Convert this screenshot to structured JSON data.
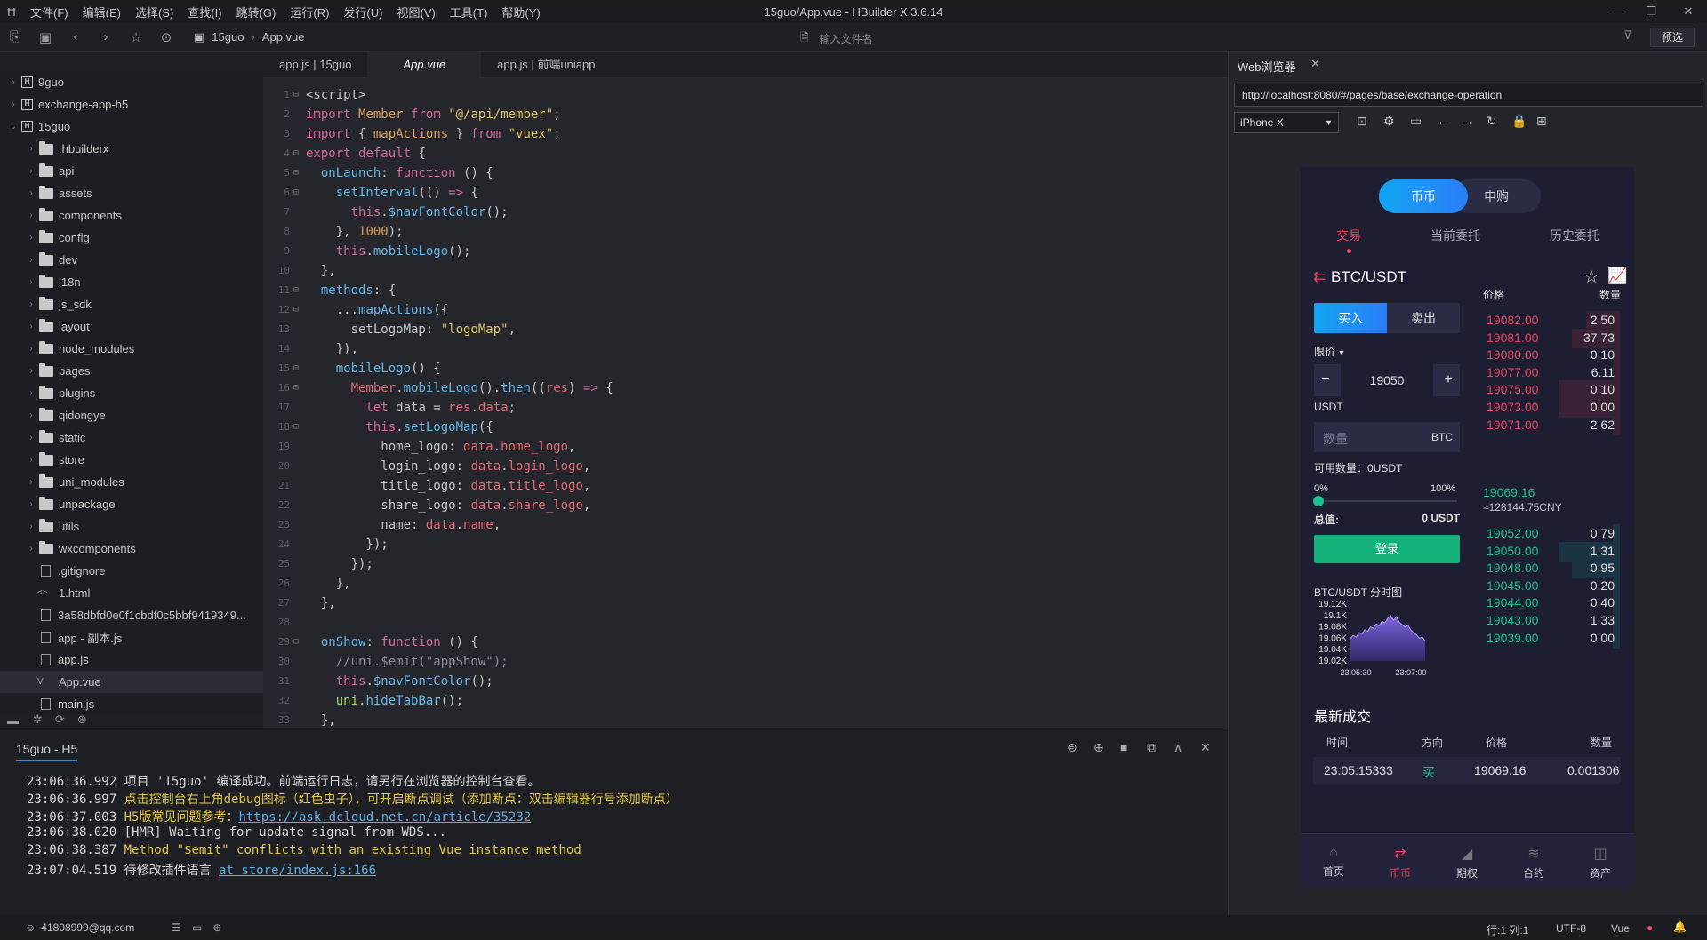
{
  "app": {
    "title": "15guo/App.vue - HBuilder X 3.6.14",
    "menu": [
      "文件(F)",
      "编辑(E)",
      "选择(S)",
      "查找(I)",
      "跳转(G)",
      "运行(R)",
      "发行(U)",
      "视图(V)",
      "工具(T)",
      "帮助(Y)"
    ]
  },
  "toolbar": {
    "breadcrumb": [
      "15guo",
      "App.vue"
    ],
    "search_placeholder": "输入文件名",
    "preview_label": "预选"
  },
  "sidebar": {
    "items": [
      {
        "label": "9guo",
        "type": "project",
        "level": 0,
        "expanded": false
      },
      {
        "label": "exchange-app-h5",
        "type": "project",
        "level": 0,
        "expanded": false
      },
      {
        "label": "15guo",
        "type": "project",
        "level": 0,
        "expanded": true
      },
      {
        "label": ".hbuilderx",
        "type": "folder",
        "level": 1
      },
      {
        "label": "api",
        "type": "folder",
        "level": 1
      },
      {
        "label": "assets",
        "type": "folder",
        "level": 1
      },
      {
        "label": "components",
        "type": "folder",
        "level": 1
      },
      {
        "label": "config",
        "type": "folder",
        "level": 1
      },
      {
        "label": "dev",
        "type": "folder",
        "level": 1
      },
      {
        "label": "i18n",
        "type": "folder",
        "level": 1
      },
      {
        "label": "js_sdk",
        "type": "folder",
        "level": 1
      },
      {
        "label": "layout",
        "type": "folder",
        "level": 1
      },
      {
        "label": "node_modules",
        "type": "folder",
        "level": 1
      },
      {
        "label": "pages",
        "type": "folder",
        "level": 1
      },
      {
        "label": "plugins",
        "type": "folder",
        "level": 1
      },
      {
        "label": "qidongye",
        "type": "folder",
        "level": 1
      },
      {
        "label": "static",
        "type": "folder",
        "level": 1
      },
      {
        "label": "store",
        "type": "folder",
        "level": 1
      },
      {
        "label": "uni_modules",
        "type": "folder",
        "level": 1
      },
      {
        "label": "unpackage",
        "type": "folder",
        "level": 1
      },
      {
        "label": "utils",
        "type": "folder",
        "level": 1
      },
      {
        "label": "wxcomponents",
        "type": "folder",
        "level": 1
      },
      {
        "label": ".gitignore",
        "type": "file",
        "level": 1
      },
      {
        "label": "1.html",
        "type": "html",
        "level": 1
      },
      {
        "label": "3a58dbfd0e0f1cbdf0c5bbf9419349...",
        "type": "file",
        "level": 1
      },
      {
        "label": "app - 副本.js",
        "type": "file",
        "level": 1
      },
      {
        "label": "app.js",
        "type": "file",
        "level": 1
      },
      {
        "label": "App.vue",
        "type": "vue",
        "level": 1,
        "selected": true
      },
      {
        "label": "main.js",
        "type": "file",
        "level": 1
      }
    ]
  },
  "editor": {
    "tabs": [
      "app.js | 15guo",
      "App.vue",
      "app.js | 前端uniapp"
    ],
    "active_tab": 1,
    "lines": [
      {
        "n": "1",
        "fold": "⊟",
        "tokens": [
          [
            "pl",
            "<script>"
          ]
        ]
      },
      {
        "n": "2",
        "tokens": [
          [
            "kw",
            "import "
          ],
          [
            "nm",
            "Member "
          ],
          [
            "kw",
            "from "
          ],
          [
            "str",
            "\"@/api/member\""
          ],
          [
            "pl",
            ";"
          ]
        ]
      },
      {
        "n": "3",
        "tokens": [
          [
            "kw",
            "import "
          ],
          [
            "pl",
            "{ "
          ],
          [
            "nm",
            "mapActions "
          ],
          [
            "pl",
            "} "
          ],
          [
            "kw",
            "from "
          ],
          [
            "str",
            "\"vuex\""
          ],
          [
            "pl",
            ";"
          ]
        ]
      },
      {
        "n": "4",
        "fold": "⊟",
        "tokens": [
          [
            "kw",
            "export default "
          ],
          [
            "pl",
            "{"
          ]
        ]
      },
      {
        "n": "5",
        "fold": "⊟",
        "tokens": [
          [
            "fn",
            "  onLaunch"
          ],
          [
            "pl",
            ": "
          ],
          [
            "kw",
            "function "
          ],
          [
            "pl",
            "() {"
          ]
        ]
      },
      {
        "n": "6",
        "fold": "⊟",
        "tokens": [
          [
            "fn",
            "    setInterval"
          ],
          [
            "pl",
            "(() "
          ],
          [
            "kw",
            "=> "
          ],
          [
            "pl",
            "{"
          ]
        ]
      },
      {
        "n": "7",
        "tokens": [
          [
            "kw",
            "      this"
          ],
          [
            "pl",
            "."
          ],
          [
            "fn",
            "$navFontColor"
          ],
          [
            "pl",
            "();"
          ]
        ]
      },
      {
        "n": "8",
        "tokens": [
          [
            "pl",
            "    }, "
          ],
          [
            "nm",
            "1000"
          ],
          [
            "pl",
            ");"
          ]
        ]
      },
      {
        "n": "9",
        "tokens": [
          [
            "kw",
            "    this"
          ],
          [
            "pl",
            "."
          ],
          [
            "fn",
            "mobileLogo"
          ],
          [
            "pl",
            "();"
          ]
        ]
      },
      {
        "n": "10",
        "tokens": [
          [
            "pl",
            "  },"
          ]
        ]
      },
      {
        "n": "11",
        "fold": "⊟",
        "tokens": [
          [
            "fn",
            "  methods"
          ],
          [
            "pl",
            ": {"
          ]
        ]
      },
      {
        "n": "12",
        "fold": "⊟",
        "tokens": [
          [
            "pl",
            "    ..."
          ],
          [
            "fn",
            "mapActions"
          ],
          [
            "pl",
            "({"
          ]
        ]
      },
      {
        "n": "13",
        "tokens": [
          [
            "pl",
            "      setLogoMap: "
          ],
          [
            "str",
            "\"logoMap\""
          ],
          [
            "pl",
            ","
          ]
        ]
      },
      {
        "n": "14",
        "tokens": [
          [
            "pl",
            "    }),"
          ]
        ]
      },
      {
        "n": "15",
        "fold": "⊟",
        "tokens": [
          [
            "fn",
            "    mobileLogo"
          ],
          [
            "pl",
            "() {"
          ]
        ]
      },
      {
        "n": "16",
        "fold": "⊟",
        "tokens": [
          [
            "vr",
            "      Member"
          ],
          [
            "pl",
            "."
          ],
          [
            "fn",
            "mobileLogo"
          ],
          [
            "pl",
            "()."
          ],
          [
            "fn",
            "then"
          ],
          [
            "pl",
            "(("
          ],
          [
            "vr",
            "res"
          ],
          [
            "pl",
            ") "
          ],
          [
            "kw",
            "=> "
          ],
          [
            "pl",
            "{"
          ]
        ]
      },
      {
        "n": "17",
        "tokens": [
          [
            "kw",
            "        let "
          ],
          [
            "pl",
            "data = "
          ],
          [
            "vr",
            "res"
          ],
          [
            "pl",
            "."
          ],
          [
            "vr",
            "data"
          ],
          [
            "pl",
            ";"
          ]
        ]
      },
      {
        "n": "18",
        "fold": "⊟",
        "tokens": [
          [
            "kw",
            "        this"
          ],
          [
            "pl",
            "."
          ],
          [
            "fn",
            "setLogoMap"
          ],
          [
            "pl",
            "({"
          ]
        ]
      },
      {
        "n": "19",
        "tokens": [
          [
            "pl",
            "          home_logo: "
          ],
          [
            "vr",
            "data"
          ],
          [
            "pl",
            "."
          ],
          [
            "vr",
            "home_logo"
          ],
          [
            "pl",
            ","
          ]
        ]
      },
      {
        "n": "20",
        "tokens": [
          [
            "pl",
            "          login_logo: "
          ],
          [
            "vr",
            "data"
          ],
          [
            "pl",
            "."
          ],
          [
            "vr",
            "login_logo"
          ],
          [
            "pl",
            ","
          ]
        ]
      },
      {
        "n": "21",
        "tokens": [
          [
            "pl",
            "          title_logo: "
          ],
          [
            "vr",
            "data"
          ],
          [
            "pl",
            "."
          ],
          [
            "vr",
            "title_logo"
          ],
          [
            "pl",
            ","
          ]
        ]
      },
      {
        "n": "22",
        "tokens": [
          [
            "pl",
            "          share_logo: "
          ],
          [
            "vr",
            "data"
          ],
          [
            "pl",
            "."
          ],
          [
            "vr",
            "share_logo"
          ],
          [
            "pl",
            ","
          ]
        ]
      },
      {
        "n": "23",
        "tokens": [
          [
            "pl",
            "          name: "
          ],
          [
            "vr",
            "data"
          ],
          [
            "pl",
            "."
          ],
          [
            "vr",
            "name"
          ],
          [
            "pl",
            ","
          ]
        ]
      },
      {
        "n": "24",
        "tokens": [
          [
            "pl",
            "        });"
          ]
        ]
      },
      {
        "n": "25",
        "tokens": [
          [
            "pl",
            "      });"
          ]
        ]
      },
      {
        "n": "26",
        "tokens": [
          [
            "pl",
            "    },"
          ]
        ]
      },
      {
        "n": "27",
        "tokens": [
          [
            "pl",
            "  },"
          ]
        ]
      },
      {
        "n": "28",
        "tokens": []
      },
      {
        "n": "29",
        "fold": "⊟",
        "tokens": [
          [
            "fn",
            "  onShow"
          ],
          [
            "pl",
            ": "
          ],
          [
            "kw",
            "function "
          ],
          [
            "pl",
            "() {"
          ]
        ]
      },
      {
        "n": "30",
        "tokens": [
          [
            "cm",
            "    //uni.$emit(\"appShow\");"
          ]
        ]
      },
      {
        "n": "31",
        "tokens": [
          [
            "kw",
            "    this"
          ],
          [
            "pl",
            "."
          ],
          [
            "fn",
            "$navFontColor"
          ],
          [
            "pl",
            "();"
          ]
        ]
      },
      {
        "n": "32",
        "tokens": [
          [
            "gr",
            "    uni"
          ],
          [
            "pl",
            "."
          ],
          [
            "fn",
            "hideTabBar"
          ],
          [
            "pl",
            "();"
          ]
        ]
      },
      {
        "n": "33",
        "tokens": [
          [
            "pl",
            "  },"
          ]
        ]
      }
    ]
  },
  "console": {
    "title": "15guo - H5",
    "lines": [
      {
        "time": "23:06:36.992",
        "parts": [
          [
            "c-white",
            "项目 '15guo' 编译成功。前端运行日志，请另行在浏览器的控制台查看。"
          ]
        ]
      },
      {
        "time": "23:06:36.997",
        "parts": [
          [
            "c-yellow",
            "点击控制台右上角debug图标（红色虫子），可开启断点调试（添加断点：双击编辑器行号添加断点）"
          ]
        ]
      },
      {
        "time": "23:06:37.003",
        "parts": [
          [
            "c-yellow",
            "H5版常见问题参考："
          ],
          [
            "c-link",
            "https://ask.dcloud.net.cn/article/35232"
          ]
        ]
      },
      {
        "time": "23:06:38.020",
        "parts": [
          [
            "c-white",
            "[HMR] Waiting for update signal from WDS..."
          ]
        ]
      },
      {
        "time": "23:06:38.387",
        "parts": [
          [
            "c-yellow",
            "Method \"$emit\" conflicts with an existing Vue instance method"
          ]
        ]
      },
      {
        "time": "23:07:04.519",
        "parts": [
          [
            "c-white",
            "待修改插件语言  "
          ],
          [
            "c-link",
            "at store/index.js:166"
          ]
        ]
      }
    ]
  },
  "statusbar": {
    "account": "41808999@qq.com",
    "position": "行:1  列:1",
    "encoding": "UTF-8",
    "language": "Vue"
  },
  "browser": {
    "title": "Web浏览器",
    "url": "http://localhost:8080/#/pages/base/exchange-operation",
    "device": "iPhone X"
  },
  "phone": {
    "segments": [
      "币币",
      "申购"
    ],
    "tabs": [
      "交易",
      "当前委托",
      "历史委托"
    ],
    "pair": "BTC/USDT",
    "buy_label": "买入",
    "sell_label": "卖出",
    "order_type": "限价",
    "price_value": "19050",
    "minus": "−",
    "plus": "+",
    "unit_label": "USDT",
    "qty_placeholder": "数量",
    "qty_unit": "BTC",
    "available": "可用数量：0USDT",
    "slider_min": "0%",
    "slider_max": "100%",
    "slider_value": 0,
    "total_label": "总值:",
    "total_value": "0 USDT",
    "login_label": "登录",
    "chart_title": "BTC/USDT 分时图",
    "ob_head_price": "价格",
    "ob_head_qty": "数量",
    "asks": [
      {
        "price": "19082.00",
        "qty": "2.50",
        "depth": 0.25
      },
      {
        "price": "19081.00",
        "qty": "37.73",
        "depth": 0.35
      },
      {
        "price": "19080.00",
        "qty": "0.10",
        "depth": 0.05
      },
      {
        "price": "19077.00",
        "qty": "6.11",
        "depth": 0.05
      },
      {
        "price": "19075.00",
        "qty": "0.10",
        "depth": 0.45
      },
      {
        "price": "19073.00",
        "qty": "0.00",
        "depth": 0.45
      },
      {
        "price": "19071.00",
        "qty": "2.62",
        "depth": 0.05
      }
    ],
    "last_price": "19069.16",
    "last_cny": "≈128144.75CNY",
    "bids": [
      {
        "price": "19052.00",
        "qty": "0.79",
        "depth": 0.05
      },
      {
        "price": "19050.00",
        "qty": "1.31",
        "depth": 0.45
      },
      {
        "price": "19048.00",
        "qty": "0.95",
        "depth": 0.35
      },
      {
        "price": "19045.00",
        "qty": "0.20",
        "depth": 0.05
      },
      {
        "price": "19044.00",
        "qty": "0.40",
        "depth": 0.05
      },
      {
        "price": "19043.00",
        "qty": "1.33",
        "depth": 0.05
      },
      {
        "price": "19039.00",
        "qty": "0.00",
        "depth": 0.05
      }
    ],
    "trades_title": "最新成交",
    "trades_head": [
      "时间",
      "方向",
      "价格",
      "数量"
    ],
    "trades": [
      {
        "time": "23:05:15333",
        "dir": "买",
        "price": "19069.16",
        "qty": "0.001306"
      }
    ],
    "nav": [
      "首页",
      "币币",
      "期权",
      "合约",
      "资产"
    ],
    "nav_active": 1,
    "colors": {
      "red": "#e8455f",
      "green": "#18c28b",
      "blue": "#1e90ff",
      "bg": "#1d1e32"
    }
  },
  "chart_data": {
    "type": "area",
    "title": "BTC/USDT 分时图",
    "yticks": [
      "19.12K",
      "19.1K",
      "19.08K",
      "19.06K",
      "19.04K",
      "19.02K"
    ],
    "xticks": [
      "23:05:30",
      "23:07:00"
    ],
    "ylim": [
      19020,
      19120
    ],
    "values": [
      19060,
      19065,
      19062,
      19070,
      19068,
      19075,
      19072,
      19080,
      19078,
      19085,
      19082,
      19090,
      19087,
      19095,
      19100,
      19092,
      19098,
      19088,
      19084,
      19080,
      19083,
      19075,
      19070,
      19066,
      19060,
      19062,
      19055
    ]
  }
}
